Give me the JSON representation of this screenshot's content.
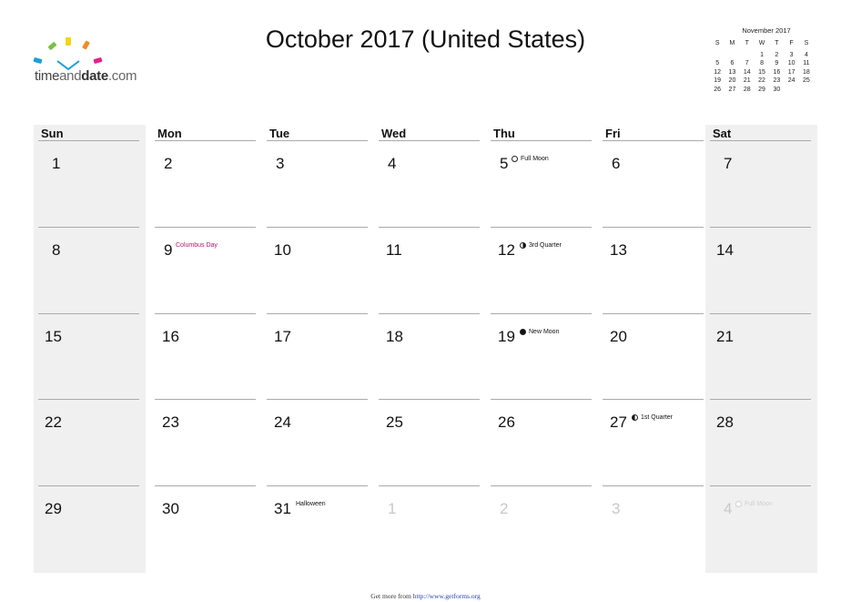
{
  "logo": {
    "text_part1": "time",
    "text_part2": "and",
    "text_part3": "date",
    "text_part4": ".com",
    "bar_colors": [
      "#1a9fd9",
      "#7cc142",
      "#f4d41a",
      "#f08a24",
      "#e6218a"
    ]
  },
  "title": "October 2017 (United States)",
  "mini_calendar": {
    "title": "November 2017",
    "weekday_headers": [
      "S",
      "M",
      "T",
      "W",
      "T",
      "F",
      "S"
    ],
    "days": [
      "",
      "",
      "",
      "1",
      "2",
      "3",
      "4",
      "5",
      "6",
      "7",
      "8",
      "9",
      "10",
      "11",
      "12",
      "13",
      "14",
      "15",
      "16",
      "17",
      "18",
      "19",
      "20",
      "21",
      "22",
      "23",
      "24",
      "25",
      "26",
      "27",
      "28",
      "29",
      "30",
      "",
      ""
    ]
  },
  "calendar": {
    "weekdays": [
      "Sun",
      "Mon",
      "Tue",
      "Wed",
      "Thu",
      "Fri",
      "Sat"
    ],
    "weeks": [
      [
        {
          "day": "1"
        },
        {
          "day": "2"
        },
        {
          "day": "3"
        },
        {
          "day": "4"
        },
        {
          "day": "5",
          "event": "Full Moon",
          "moon": "full"
        },
        {
          "day": "6"
        },
        {
          "day": "7"
        }
      ],
      [
        {
          "day": "8"
        },
        {
          "day": "9",
          "event": "Columbus Day",
          "holiday": true
        },
        {
          "day": "10"
        },
        {
          "day": "11"
        },
        {
          "day": "12",
          "event": "3rd Quarter",
          "moon": "third"
        },
        {
          "day": "13"
        },
        {
          "day": "14"
        }
      ],
      [
        {
          "day": "15"
        },
        {
          "day": "16"
        },
        {
          "day": "17"
        },
        {
          "day": "18"
        },
        {
          "day": "19",
          "event": "New Moon",
          "moon": "new"
        },
        {
          "day": "20"
        },
        {
          "day": "21"
        }
      ],
      [
        {
          "day": "22"
        },
        {
          "day": "23"
        },
        {
          "day": "24"
        },
        {
          "day": "25"
        },
        {
          "day": "26"
        },
        {
          "day": "27",
          "event": "1st Quarter",
          "moon": "first"
        },
        {
          "day": "28"
        }
      ],
      [
        {
          "day": "29"
        },
        {
          "day": "30"
        },
        {
          "day": "31",
          "event": "Halloween"
        },
        {
          "day": "1",
          "faded": true
        },
        {
          "day": "2",
          "faded": true
        },
        {
          "day": "3",
          "faded": true
        },
        {
          "day": "4",
          "faded": true,
          "event": "Full Moon",
          "moon": "full"
        }
      ]
    ]
  },
  "footer": {
    "text": "Get more from ",
    "link": "http://www.getforms.org"
  }
}
